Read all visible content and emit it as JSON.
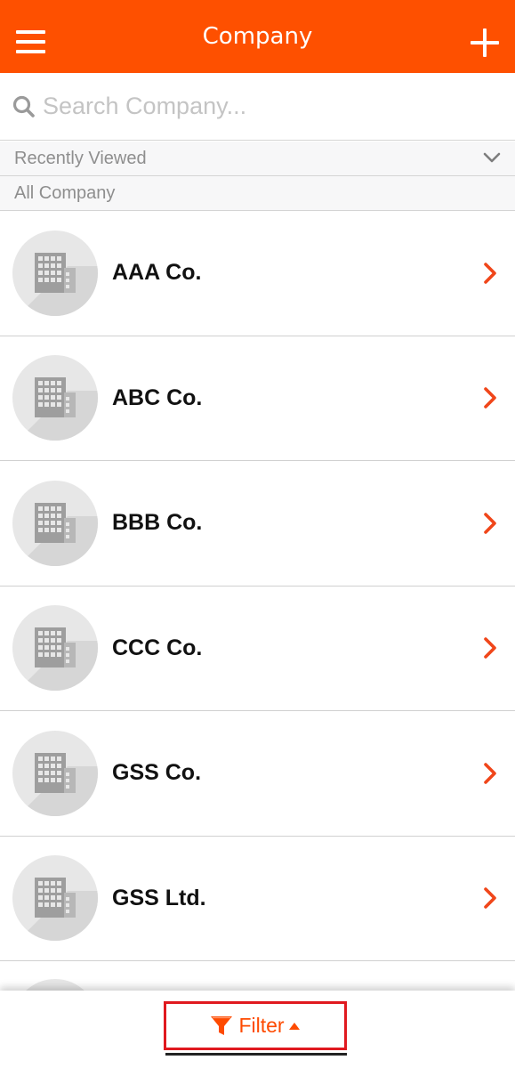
{
  "header": {
    "title": "Company",
    "menu_icon": "hamburger-menu-icon",
    "add_icon": "plus-icon",
    "background_color": "#fe5000"
  },
  "search": {
    "placeholder": "Search Company...",
    "value": "",
    "icon": "search-icon"
  },
  "sections": {
    "recently_viewed": "Recently Viewed",
    "all_company": "All Company"
  },
  "companies": [
    {
      "name": "AAA Co."
    },
    {
      "name": "ABC Co."
    },
    {
      "name": "BBB Co."
    },
    {
      "name": "CCC Co."
    },
    {
      "name": "GSS Co."
    },
    {
      "name": "GSS Ltd."
    }
  ],
  "bottom_bar": {
    "filter_label": "Filter",
    "filter_icon": "funnel-icon",
    "caret_icon": "caret-up-icon",
    "accent_color": "#fe4a00",
    "highlight_color": "#e0191f"
  }
}
